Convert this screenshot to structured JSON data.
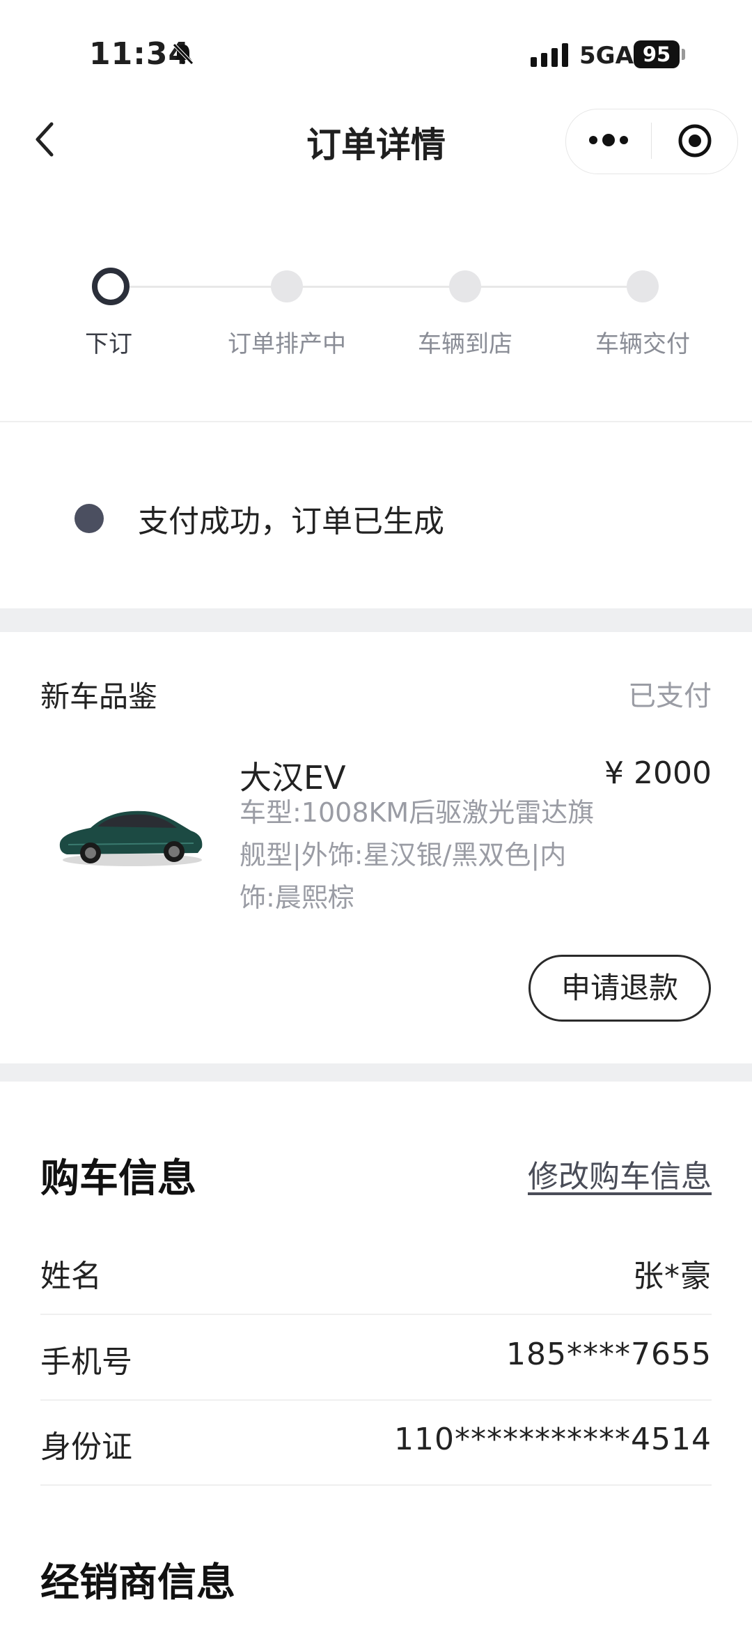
{
  "status_bar": {
    "time": "11:34",
    "network": "5GA",
    "battery": "95",
    "icons": [
      "bell-muted-icon",
      "signal-icon",
      "battery-icon"
    ]
  },
  "nav": {
    "title": "订单详情",
    "icons": [
      "back-arrow-icon",
      "more-dots-icon",
      "target-icon"
    ]
  },
  "progress": {
    "steps": [
      {
        "label": "下订",
        "active": true
      },
      {
        "label": "订单排产中",
        "active": false
      },
      {
        "label": "车辆到店",
        "active": false
      },
      {
        "label": "车辆交付",
        "active": false
      }
    ]
  },
  "order_status": {
    "text": "支付成功，订单已生成"
  },
  "product": {
    "section_title": "新车品鉴",
    "payment_state": "已支付",
    "model": "大汉EV",
    "price": "¥ 2000",
    "spec_lines": [
      "车型:1008KM后驱激光雷达旗",
      "舰型|外饰:星汉银/黑双色|内",
      "饰:晨熙棕"
    ],
    "refund_button": "申请退款",
    "image_icon": "car-image"
  },
  "purchase_info": {
    "title": "购车信息",
    "edit_link": "修改购车信息",
    "rows": [
      {
        "label": "姓名",
        "value": "张*豪"
      },
      {
        "label": "手机号",
        "value": "185****7655"
      },
      {
        "label": "身份证",
        "value": "110***********4514"
      }
    ]
  },
  "dealer_info": {
    "title": "经销商信息"
  },
  "colors": {
    "active_step": "#2b2f3a",
    "inactive_step": "#e6e6e8",
    "muted_text": "#9a9ca4",
    "section_band": "#eeeff1",
    "status_dot": "#4b4f60"
  }
}
